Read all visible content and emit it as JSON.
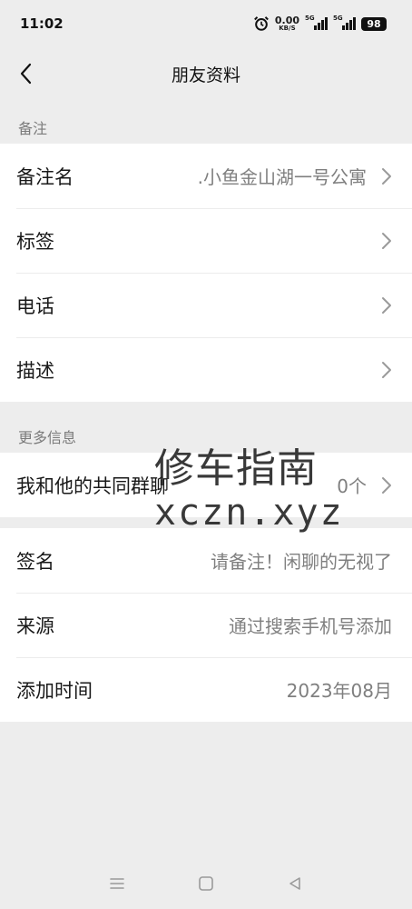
{
  "status_bar": {
    "time": "11:02",
    "net_speed_value": "0.00",
    "net_speed_unit": "KB/S",
    "signal1_tag": "5G",
    "signal2_tag": "5G",
    "battery": "98"
  },
  "header": {
    "title": "朋友资料"
  },
  "sections": {
    "remark_label": "备注",
    "more_label": "更多信息"
  },
  "remark_rows": [
    {
      "label": "备注名",
      "value": ".小鱼金山湖一号公寓"
    },
    {
      "label": "标签",
      "value": ""
    },
    {
      "label": "电话",
      "value": ""
    },
    {
      "label": "描述",
      "value": ""
    }
  ],
  "common_groups": {
    "label": "我和他的共同群聊",
    "value": "0个"
  },
  "info_rows": [
    {
      "label": "签名",
      "value": "请备注！闲聊的无视了"
    },
    {
      "label": "来源",
      "value": "通过搜索手机号添加"
    },
    {
      "label": "添加时间",
      "value": "2023年08月"
    }
  ],
  "watermark": {
    "line1": "修车指南",
    "line2": "xczn.xyz"
  },
  "colors": {
    "background": "#ededed",
    "card": "#ffffff",
    "secondary_text": "#7f7f7f"
  }
}
